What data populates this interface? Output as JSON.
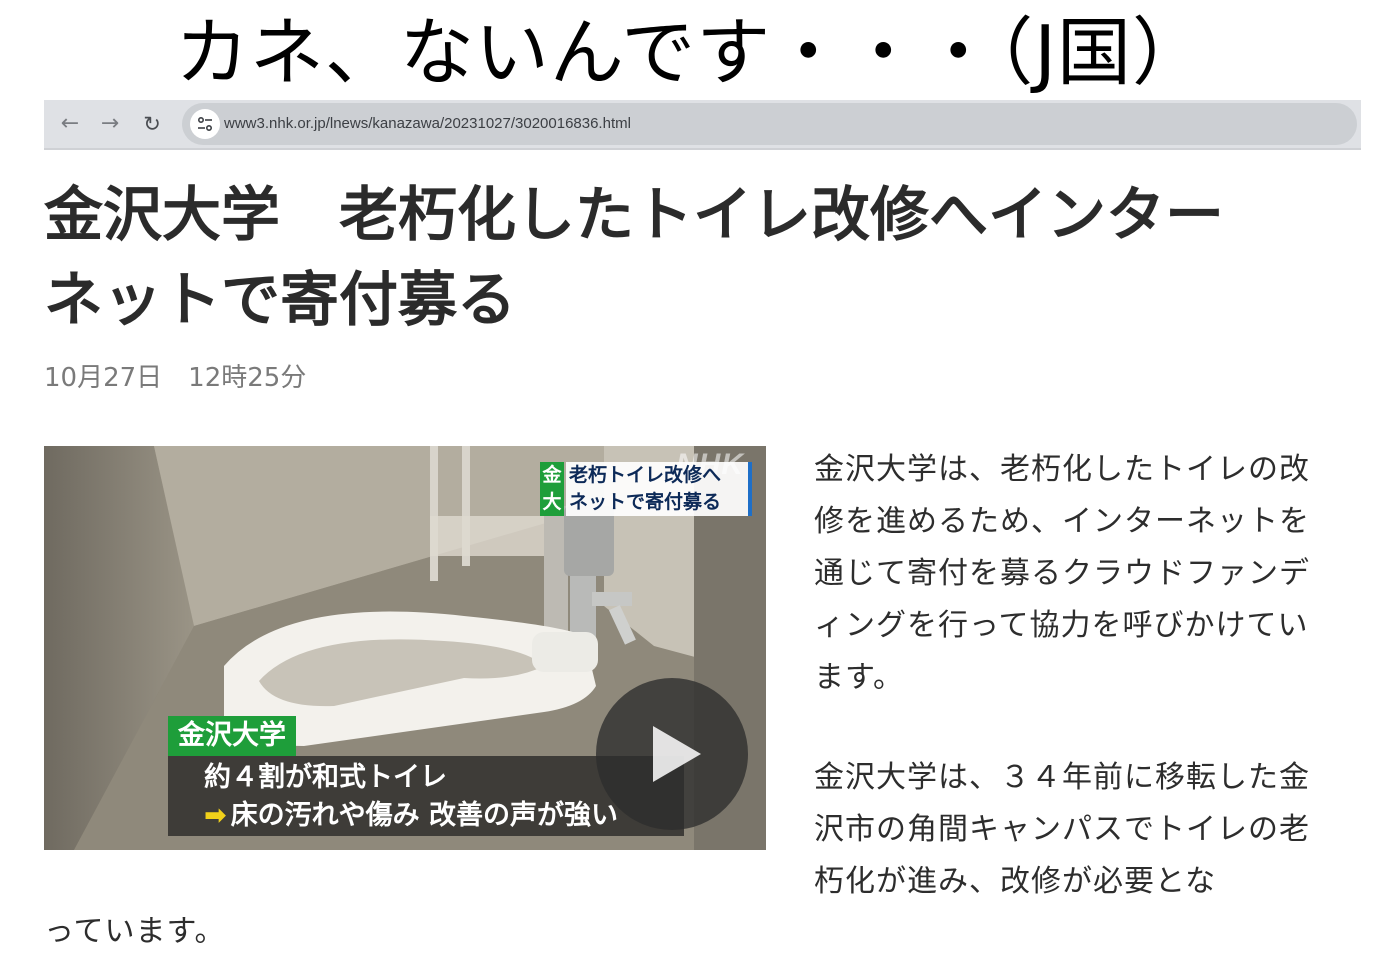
{
  "meme_caption": "カネ、ないんです・・・（J国）",
  "browser": {
    "back_icon": "arrow-left-icon",
    "forward_icon": "arrow-right-icon",
    "reload_icon": "reload-icon",
    "site_info_icon": "tune-icon",
    "url": "www3.nhk.or.jp/lnews/kanazawa/20231027/3020016836.html"
  },
  "article": {
    "headline_line1": "金沢大学　老朽化したトイレ改修へインター",
    "headline_line2": "ネットで寄付募る",
    "date": "10月27日　12時25分",
    "paragraph1": "金沢大学は、老朽化したトイレの改修を進めるため、インターネットを通じて寄付を募るクラウドファンディングを行って協力を呼びかけています。",
    "paragraph2_wrapped": "金沢大学は、３４年前に移転した金沢市の角間キャンパスでトイレの老朽化が進み、改修が必要とな",
    "paragraph2_tail": "っています。"
  },
  "video": {
    "logo": "NHK",
    "top_caption_tag": [
      "金",
      "大"
    ],
    "top_caption_lines": [
      "老朽トイレ改修へ",
      "ネットで寄付募る"
    ],
    "lower_tag": "金沢大学",
    "lower_line1": "約４割が和式トイレ",
    "lower_line2": "床の汚れや傷み 改善の声が強い",
    "play_icon": "play-icon"
  },
  "colors": {
    "caption_green": "#1e9e3a",
    "caption_navy": "#0d2a58",
    "browser_bar": "#dfe1e5"
  }
}
